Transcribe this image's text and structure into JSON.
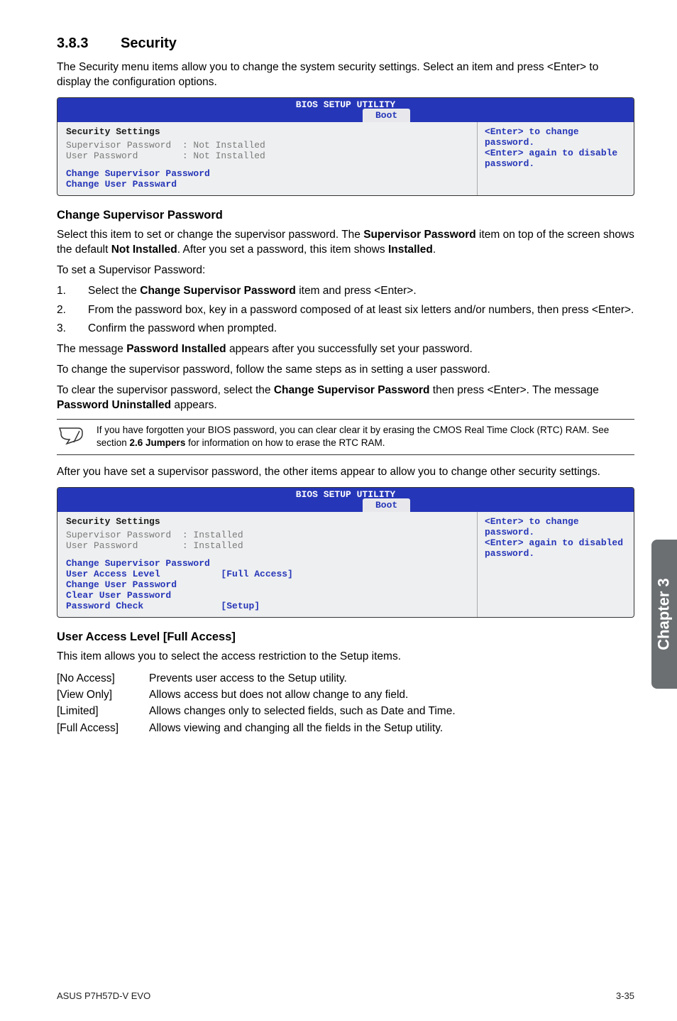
{
  "heading": {
    "number": "3.8.3",
    "title": "Security"
  },
  "intro": "The Security menu items allow you to change the system security settings. Select an item and press <Enter> to display the configuration options.",
  "bios1": {
    "utility_title": "BIOS SETUP UTILITY",
    "tab": "Boot",
    "section": "Security Settings",
    "rows": [
      "Supervisor Password  : Not Installed",
      "User Password        : Not Installed"
    ],
    "actions": [
      "Change Supervisor Password",
      "Change User Passward"
    ],
    "help": "<Enter> to change password.\n<Enter> again to disable password."
  },
  "csp_heading": "Change Supervisor Password",
  "csp_p1a": "Select this item to set or change the supervisor password. The ",
  "csp_p1b": "Supervisor Password",
  "csp_p1c": " item on top of the screen shows the default ",
  "csp_p1d": "Not Installed",
  "csp_p1e": ". After you set a password, this item shows ",
  "csp_p1f": "Installed",
  "csp_p1g": ".",
  "csp_set": "To set a Supervisor Password:",
  "csp_steps": [
    {
      "n": "1.",
      "a": "Select the ",
      "b": "Change Supervisor Password",
      "c": " item and press <Enter>."
    },
    {
      "n": "2.",
      "a": "From the password box, key in a password composed of at least six letters and/or numbers, then press <Enter>.",
      "b": "",
      "c": ""
    },
    {
      "n": "3.",
      "a": "Confirm the password when prompted.",
      "b": "",
      "c": ""
    }
  ],
  "csp_msg_a": "The message ",
  "csp_msg_b": "Password Installed",
  "csp_msg_c": " appears after you successfully set your password.",
  "csp_change": "To change the supervisor password, follow the same steps as in setting a user password.",
  "csp_clear_a": "To clear the supervisor password, select the ",
  "csp_clear_b": "Change Supervisor Password",
  "csp_clear_c": " then press <Enter>. The message ",
  "csp_clear_d": "Password Uninstalled",
  "csp_clear_e": " appears.",
  "note_a": "If you have forgotten your BIOS password, you can clear clear it by erasing the CMOS Real Time Clock (RTC) RAM. See section ",
  "note_b": "2.6 Jumpers",
  "note_c": " for information on how to erase the RTC RAM.",
  "after_note": "After you have set a supervisor password, the other items appear to allow you to change other security settings.",
  "bios2": {
    "utility_title": "BIOS SETUP UTILITY",
    "tab": "Boot",
    "section": "Security Settings",
    "rows": [
      "Supervisor Password  : Installed",
      "User Password        : Installed"
    ],
    "blue_lines": [
      "Change Supervisor Password",
      "User Access Level           [Full Access]",
      "Change User Password",
      "Clear User Password",
      "Password Check              [Setup]"
    ],
    "help": "<Enter> to change password.\n<Enter> again to disabled password."
  },
  "ual_heading": "User Access Level [Full Access]",
  "ual_intro": "This item allows you to select the access restriction to the Setup items.",
  "ual_options": [
    {
      "k": "[No Access]",
      "v": "Prevents user access to the Setup utility."
    },
    {
      "k": "[View Only]",
      "v": "Allows access but does not allow change to any field."
    },
    {
      "k": "[Limited]",
      "v": "Allows changes only to selected fields, such as Date and Time."
    },
    {
      "k": "[Full Access]",
      "v": "Allows viewing and changing all the fields in the Setup utility."
    }
  ],
  "side_tab": "Chapter 3",
  "footer_left": "ASUS P7H57D-V EVO",
  "footer_right": "3-35"
}
